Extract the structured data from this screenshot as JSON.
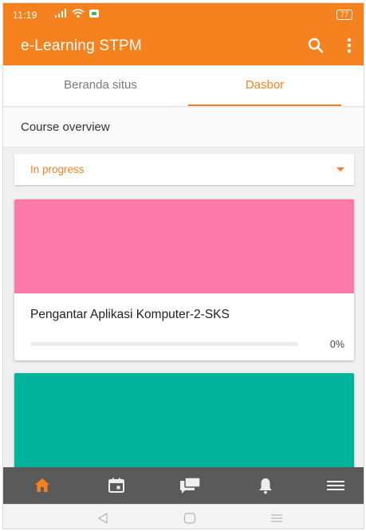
{
  "status_bar": {
    "time": "11:19",
    "battery": "77",
    "icons": [
      "signal-icon",
      "wifi-icon",
      "chat-notification-icon",
      "battery-icon"
    ]
  },
  "app_bar": {
    "title": "e-Learning STPM",
    "icons": [
      "search-icon",
      "more-vert-icon"
    ]
  },
  "tabs": [
    {
      "label": "Beranda situs",
      "active": false
    },
    {
      "label": "Dasbor",
      "active": true
    }
  ],
  "overview": {
    "heading": "Course overview",
    "filter_value": "In progress"
  },
  "courses": [
    {
      "name": "Pengantar Aplikasi Komputer-2-SKS",
      "progress": 0,
      "progress_label": "0%",
      "color": "#fc7aa8"
    },
    {
      "name": "",
      "color": "#00b39b"
    }
  ],
  "bottom_nav": [
    {
      "icon": "home-icon",
      "active": true
    },
    {
      "icon": "calendar-icon",
      "active": false
    },
    {
      "icon": "messages-icon",
      "active": false
    },
    {
      "icon": "notifications-icon",
      "active": false
    },
    {
      "icon": "menu-icon",
      "active": false
    }
  ],
  "system_nav": [
    "back-icon",
    "home-circle-icon",
    "recents-icon"
  ],
  "colors": {
    "accent": "#f5821f",
    "nav_bg": "#5a5a5a",
    "nav_icon": "#eeeeee"
  }
}
